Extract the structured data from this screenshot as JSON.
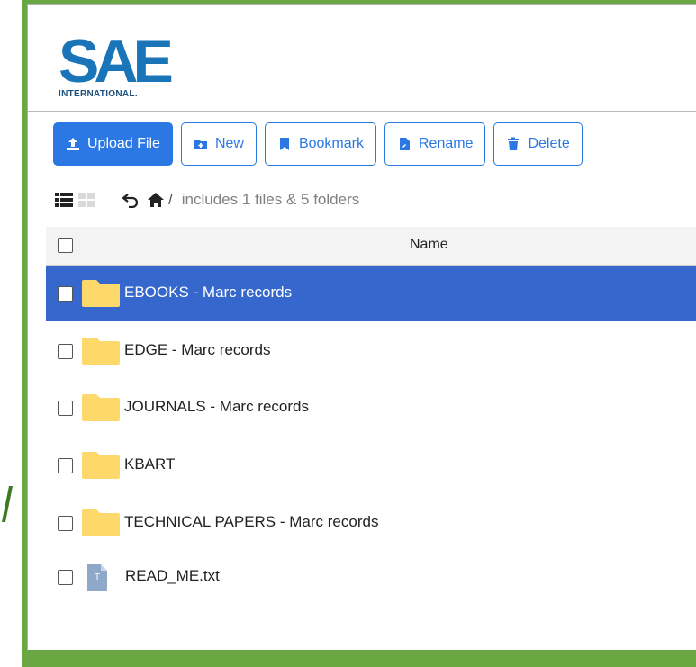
{
  "logo": {
    "text": "SAE",
    "subtitle": "INTERNATIONAL."
  },
  "toolbar": {
    "upload_label": "Upload File",
    "new_label": "New",
    "bookmark_label": "Bookmark",
    "rename_label": "Rename",
    "delete_label": "Delete"
  },
  "info": {
    "path_separator": "/",
    "summary": "includes 1 files & 5 folders"
  },
  "table": {
    "name_header": "Name"
  },
  "rows": [
    {
      "name": "EBOOKS - Marc records",
      "type": "folder",
      "selected": true
    },
    {
      "name": "EDGE - Marc records",
      "type": "folder",
      "selected": false
    },
    {
      "name": "JOURNALS - Marc records",
      "type": "folder",
      "selected": false
    },
    {
      "name": "KBART",
      "type": "folder",
      "selected": false
    },
    {
      "name": "TECHNICAL PAPERS - Marc records",
      "type": "folder",
      "selected": false
    },
    {
      "name": "READ_ME.txt",
      "type": "file",
      "file_badge": "T",
      "selected": false
    }
  ],
  "colors": {
    "accent": "#2b78e4",
    "selected_row": "#3567cd",
    "frame_green": "#6aa641",
    "folder": "#fdd86b",
    "logo_blue": "#1a74b8"
  }
}
